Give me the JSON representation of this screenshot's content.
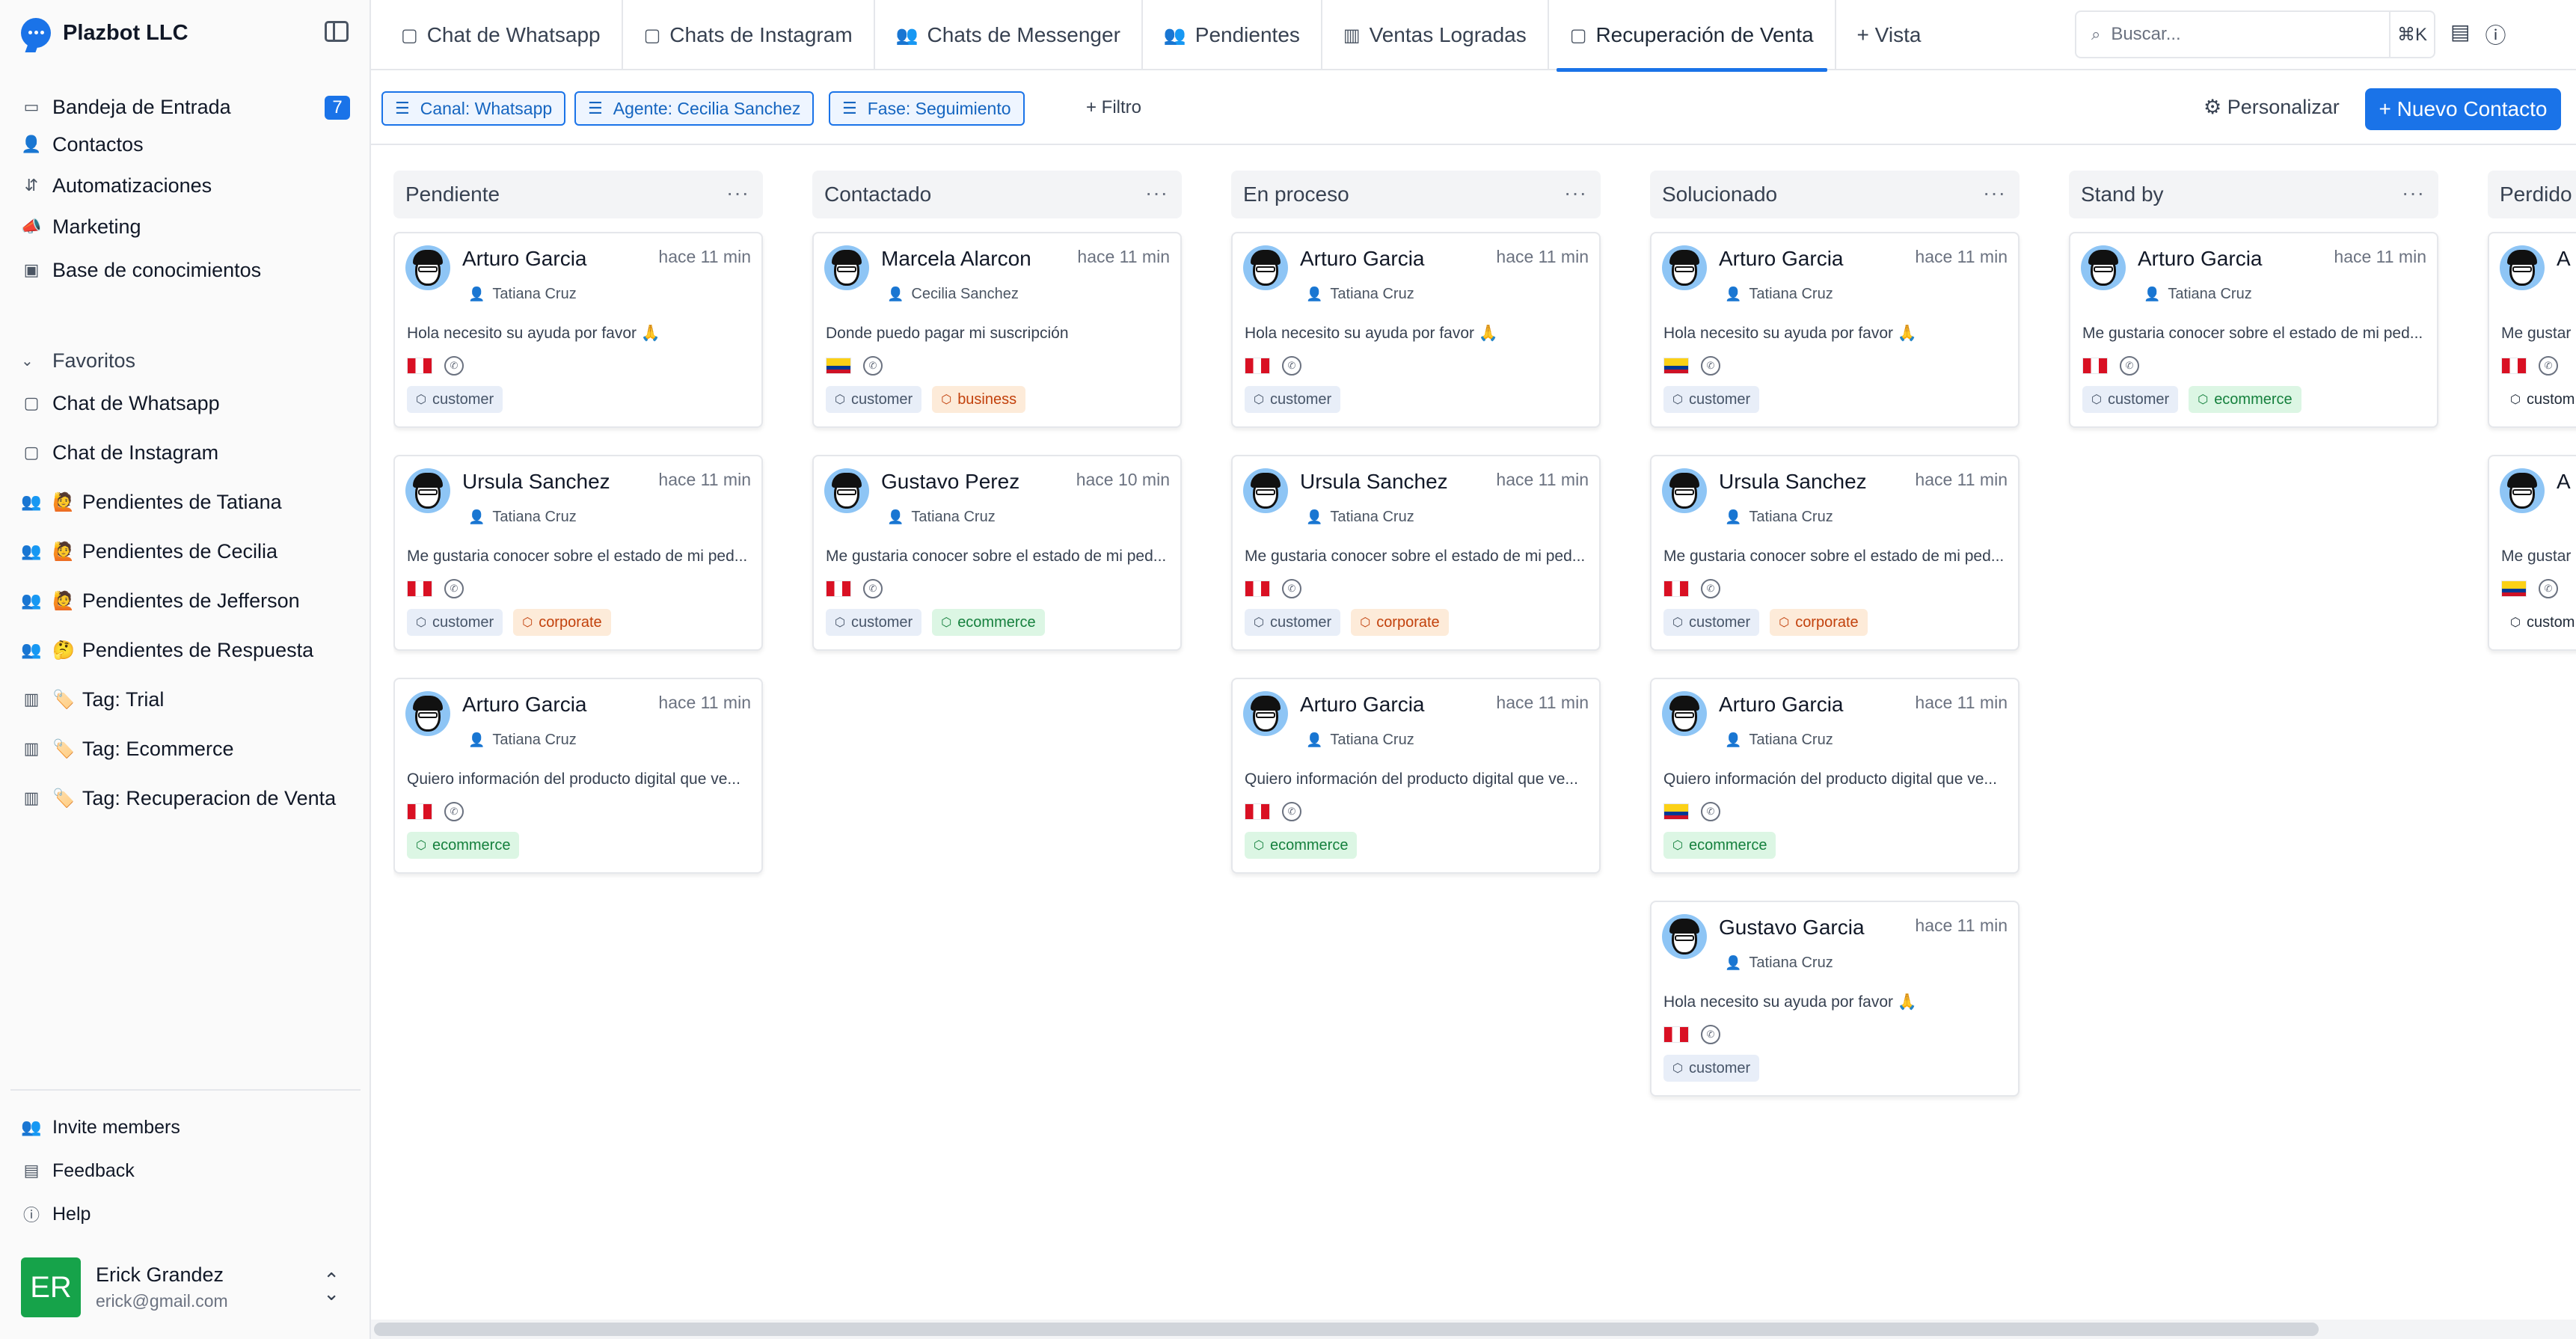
{
  "brand": {
    "name": "Plazbot LLC"
  },
  "nav": [
    {
      "label": "Bandeja de Entrada",
      "icon": "inbox-icon",
      "badge": "7"
    },
    {
      "label": "Contactos",
      "icon": "user-icon"
    },
    {
      "label": "Automatizaciones",
      "icon": "flow-icon"
    },
    {
      "label": "Marketing",
      "icon": "megaphone-icon"
    },
    {
      "label": "Base de conocimientos",
      "icon": "book-icon"
    }
  ],
  "favorites": {
    "title": "Favoritos",
    "items": [
      {
        "label": "Chat de Whatsapp",
        "emoji": ""
      },
      {
        "label": "Chat de Instagram",
        "emoji": ""
      },
      {
        "label": "Pendientes de Tatiana",
        "emoji": "🙋"
      },
      {
        "label": "Pendientes de Cecilia",
        "emoji": "🙋"
      },
      {
        "label": "Pendientes de Jefferson",
        "emoji": "🙋"
      },
      {
        "label": "Pendientes de Respuesta",
        "emoji": "🤔"
      },
      {
        "label": "Tag: Trial",
        "emoji": "🏷️"
      },
      {
        "label": "Tag: Ecommerce",
        "emoji": "🏷️"
      },
      {
        "label": "Tag: Recuperacion de Venta",
        "emoji": "🏷️"
      }
    ]
  },
  "bottom_nav": [
    {
      "label": "Invite members"
    },
    {
      "label": "Feedback"
    },
    {
      "label": "Help"
    }
  ],
  "user": {
    "initials": "ER",
    "name": "Erick Grandez",
    "email": "erick@gmail.com"
  },
  "tabs": [
    {
      "label": "Chat de Whatsapp",
      "icon": "chat-icon"
    },
    {
      "label": "Chats de Instagram",
      "icon": "chat-icon"
    },
    {
      "label": "Chats de Messenger",
      "icon": "users-icon"
    },
    {
      "label": "Pendientes",
      "icon": "users-icon"
    },
    {
      "label": "Ventas Logradas",
      "icon": "chart-icon"
    },
    {
      "label": "Recuperación de Venta",
      "icon": "chat-icon",
      "active": true
    },
    {
      "label": "+ Vista",
      "icon": ""
    }
  ],
  "search": {
    "placeholder": "Buscar...",
    "shortcut": "⌘K"
  },
  "filters": [
    {
      "label": "Canal: Whatsapp"
    },
    {
      "label": "Agente: Cecilia Sanchez"
    },
    {
      "label": "Fase: Seguimiento"
    }
  ],
  "add_filter": "+ Filtro",
  "personalize": "Personalizar",
  "new_contact": "+ Nuevo Contacto",
  "columns": [
    {
      "title": "Pendiente",
      "cards": [
        {
          "name": "Arturo Garcia",
          "time": "hace 11 min",
          "agent": "Tatiana Cruz",
          "message": "Hola necesito su ayuda por favor 🙏",
          "flag": "pe",
          "tags": [
            "customer"
          ]
        },
        {
          "name": "Ursula Sanchez",
          "time": "hace 11 min",
          "agent": "Tatiana Cruz",
          "message": "Me gustaria conocer sobre el estado de mi ped...",
          "flag": "pe",
          "tags": [
            "customer",
            "corporate"
          ]
        },
        {
          "name": "Arturo Garcia",
          "time": "hace 11 min",
          "agent": "Tatiana Cruz",
          "message": "Quiero información del producto digital que ve...",
          "flag": "pe",
          "tags": [
            "ecommerce"
          ]
        }
      ]
    },
    {
      "title": "Contactado",
      "cards": [
        {
          "name": "Marcela Alarcon",
          "time": "hace 11 min",
          "agent": "Cecilia Sanchez",
          "message": "Donde puedo pagar mi suscripción",
          "flag": "co",
          "tags": [
            "customer",
            "business"
          ]
        },
        {
          "name": "Gustavo Perez",
          "time": "hace 10 min",
          "agent": "Tatiana Cruz",
          "message": "Me gustaria conocer sobre el estado de mi ped...",
          "flag": "pe",
          "tags": [
            "customer",
            "ecommerce"
          ]
        }
      ]
    },
    {
      "title": "En proceso",
      "cards": [
        {
          "name": "Arturo Garcia",
          "time": "hace 11 min",
          "agent": "Tatiana Cruz",
          "message": "Hola necesito su ayuda por favor 🙏",
          "flag": "pe",
          "tags": [
            "customer"
          ]
        },
        {
          "name": "Ursula Sanchez",
          "time": "hace 11 min",
          "agent": "Tatiana Cruz",
          "message": "Me gustaria conocer sobre el estado de mi ped...",
          "flag": "pe",
          "tags": [
            "customer",
            "corporate"
          ]
        },
        {
          "name": "Arturo Garcia",
          "time": "hace 11 min",
          "agent": "Tatiana Cruz",
          "message": "Quiero información del producto digital que ve...",
          "flag": "pe",
          "tags": [
            "ecommerce"
          ]
        }
      ]
    },
    {
      "title": "Solucionado",
      "cards": [
        {
          "name": "Arturo Garcia",
          "time": "hace 11 min",
          "agent": "Tatiana Cruz",
          "message": "Hola necesito su ayuda por favor 🙏",
          "flag": "co",
          "tags": [
            "customer"
          ]
        },
        {
          "name": "Ursula Sanchez",
          "time": "hace 11 min",
          "agent": "Tatiana Cruz",
          "message": "Me gustaria conocer sobre el estado de mi ped...",
          "flag": "pe",
          "tags": [
            "customer",
            "corporate"
          ]
        },
        {
          "name": "Arturo Garcia",
          "time": "hace 11 min",
          "agent": "Tatiana Cruz",
          "message": "Quiero información del producto digital que ve...",
          "flag": "co",
          "tags": [
            "ecommerce"
          ]
        },
        {
          "name": "Gustavo Garcia",
          "time": "hace 11 min",
          "agent": "Tatiana Cruz",
          "message": "Hola necesito su ayuda por favor 🙏",
          "flag": "pe",
          "tags": [
            "customer"
          ]
        }
      ]
    },
    {
      "title": "Stand by",
      "cards": [
        {
          "name": "Arturo Garcia",
          "time": "hace 11 min",
          "agent": "Tatiana Cruz",
          "message": "Me gustaria conocer sobre el estado de mi ped...",
          "flag": "pe",
          "tags": [
            "customer",
            "ecommerce"
          ]
        }
      ]
    },
    {
      "title": "Perdido",
      "cards": [
        {
          "name": "A",
          "time": "",
          "agent": "",
          "message": "Me gustar",
          "flag": "pe",
          "tags": [
            "custom"
          ]
        },
        {
          "name": "A",
          "time": "",
          "agent": "",
          "message": "Me gustar",
          "flag": "co",
          "tags": [
            "custom"
          ]
        }
      ]
    }
  ],
  "colors": {
    "accent": "#1a73e8",
    "avatar_user": "#16a34a"
  }
}
